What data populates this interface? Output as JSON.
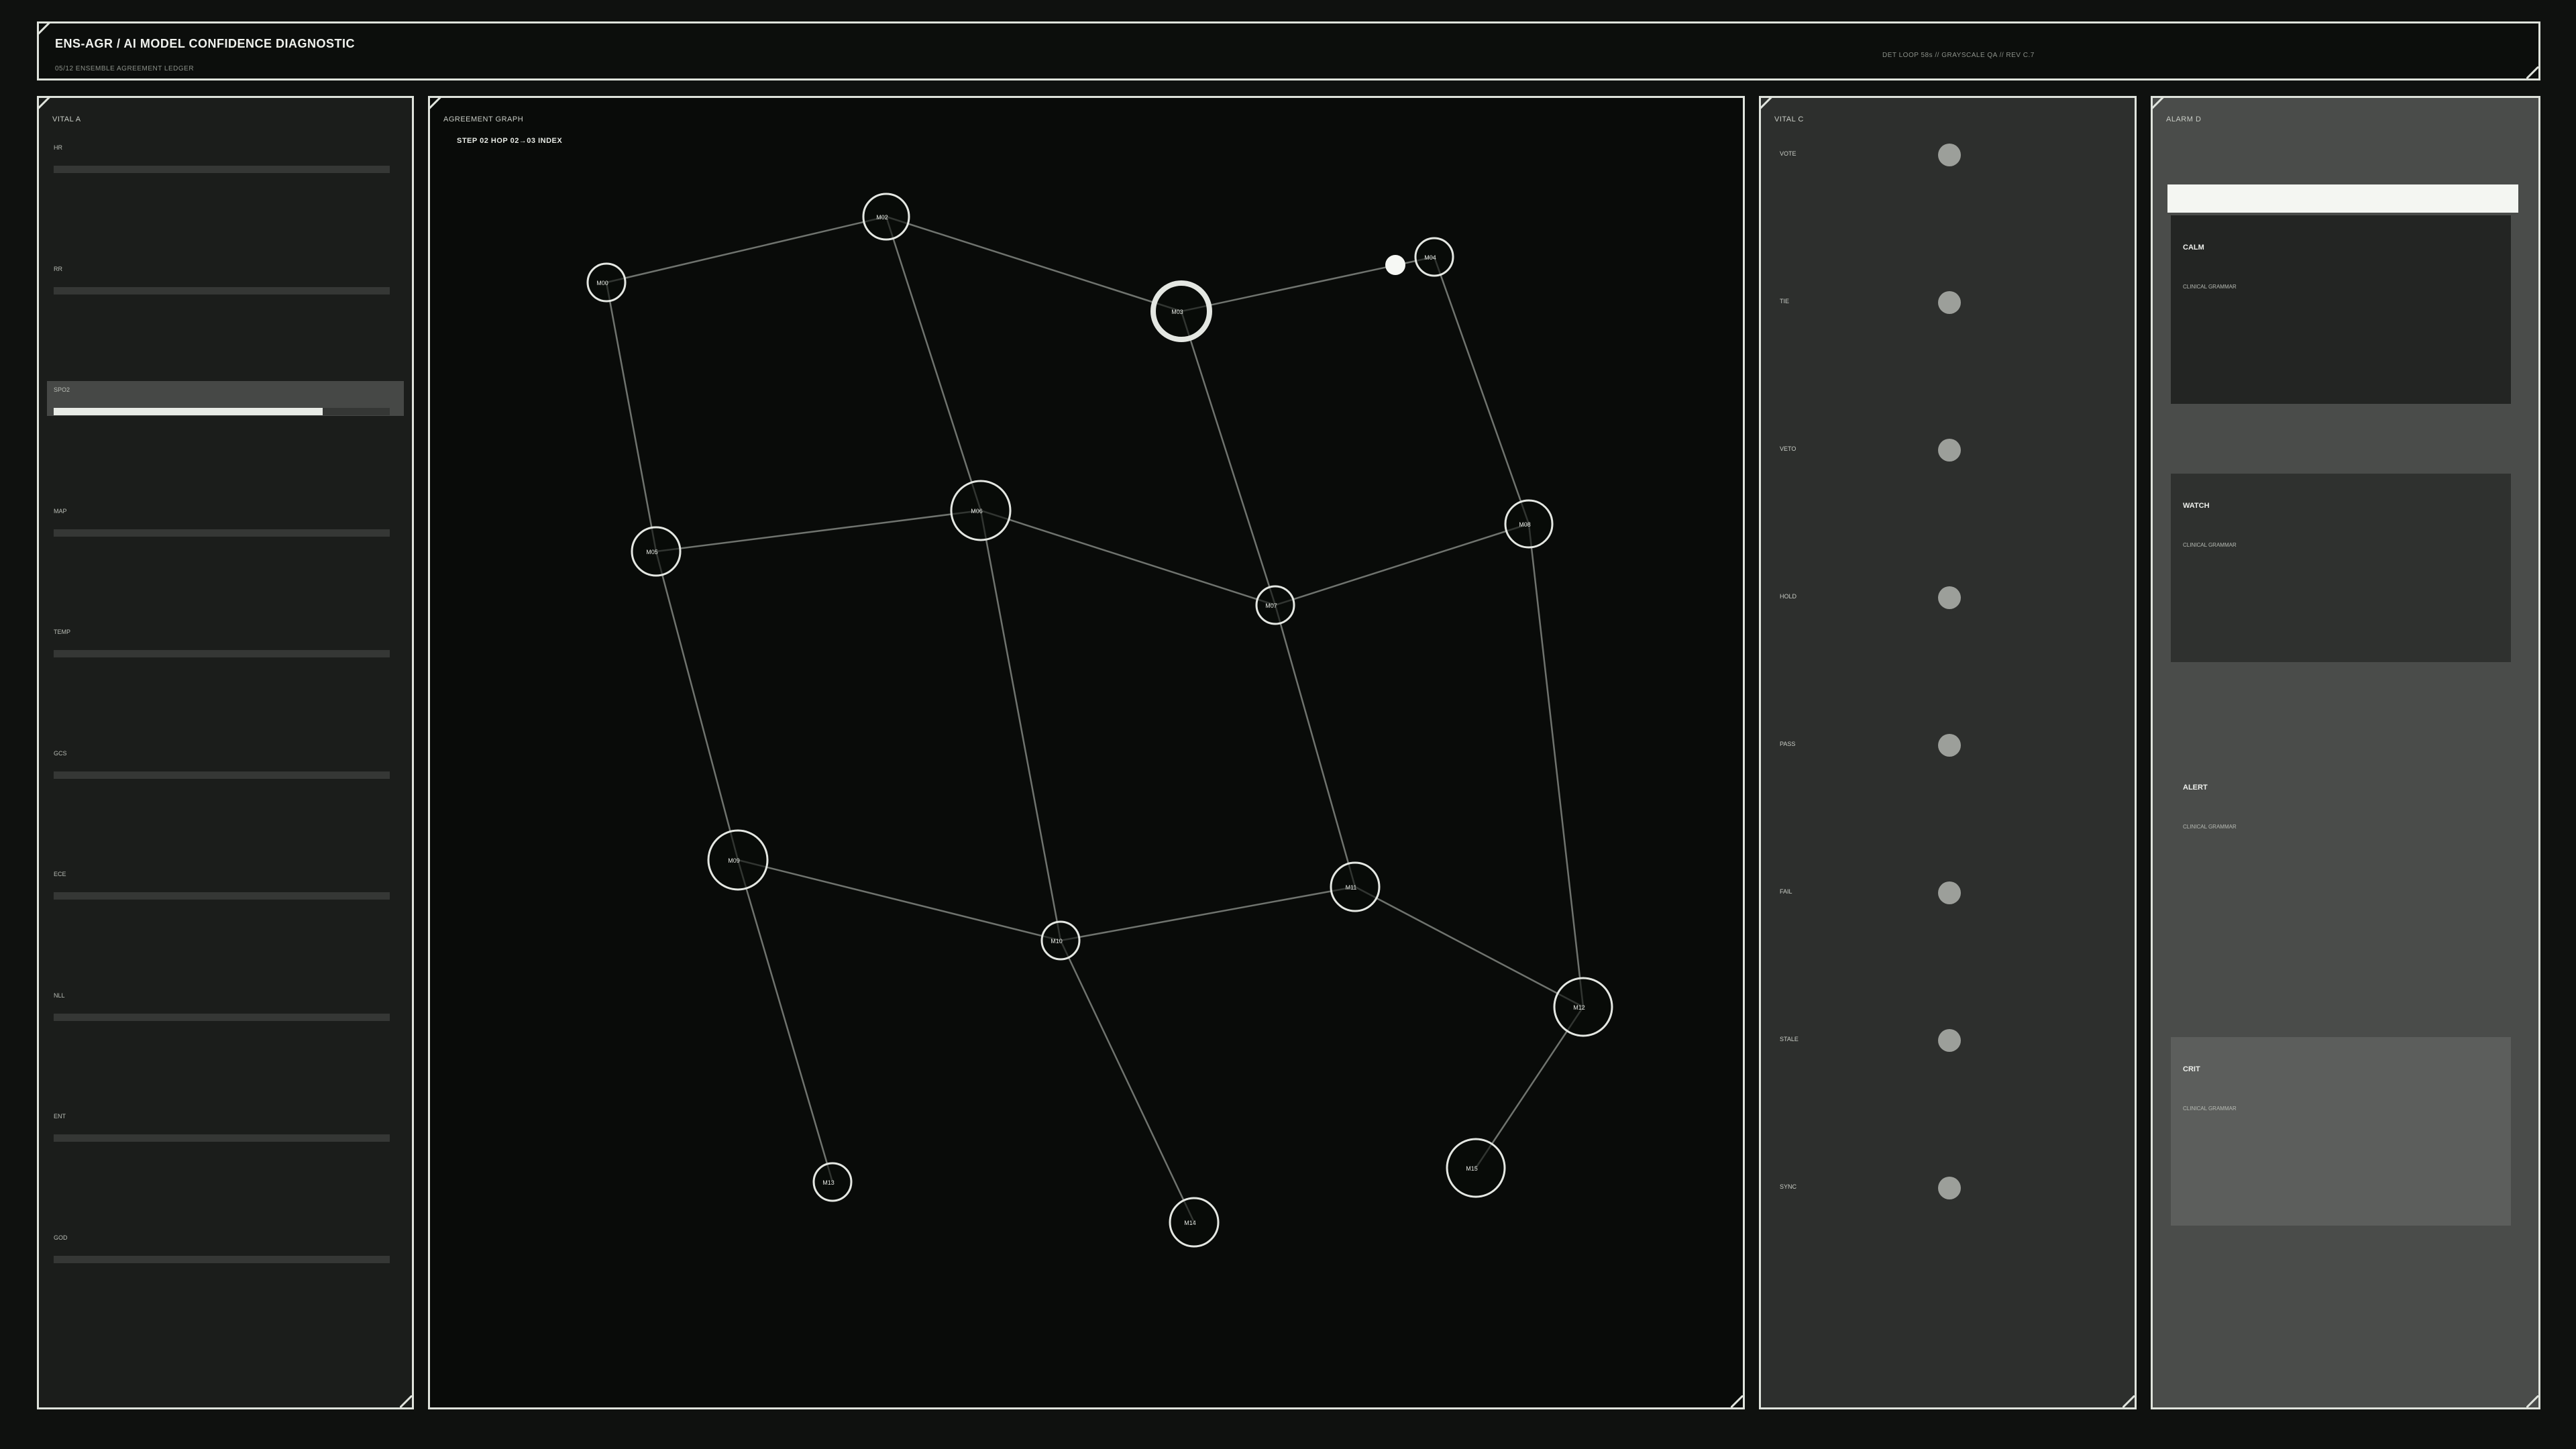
{
  "header": {
    "title": "ENS-AGR  /  AI MODEL CONFIDENCE DIAGNOSTIC",
    "subtitle": "05/12  ENSEMBLE AGREEMENT LEDGER",
    "meta": "DET LOOP 58s  //  GRAYSCALE QA  //  REV C.7"
  },
  "vital_a": {
    "label": "VITAL A",
    "rows": [
      {
        "label": "HR",
        "value": 0.0,
        "active": false
      },
      {
        "label": "RR",
        "value": 0.0,
        "active": false
      },
      {
        "label": "SPO2",
        "value": 0.8,
        "active": true
      },
      {
        "label": "MAP",
        "value": 0.0,
        "active": false
      },
      {
        "label": "TEMP",
        "value": 0.0,
        "active": false
      },
      {
        "label": "GCS",
        "value": 0.0,
        "active": false
      },
      {
        "label": "ECE",
        "value": 0.0,
        "active": false
      },
      {
        "label": "NLL",
        "value": 0.0,
        "active": false
      },
      {
        "label": "ENT",
        "value": 0.0,
        "active": false
      },
      {
        "label": "GOD",
        "value": 0.0,
        "active": false
      }
    ]
  },
  "graph": {
    "label": "AGREEMENT GRAPH",
    "step": "STEP 02  HOP 02→03  INDEX",
    "nodes": [
      {
        "id": "M00",
        "label": "M00",
        "r": 28
      },
      {
        "id": "M02",
        "label": "M02",
        "r": 34
      },
      {
        "id": "M03",
        "label": "M03",
        "r": 42,
        "active": true
      },
      {
        "id": "M04",
        "label": "M04",
        "r": 28
      },
      {
        "id": "M05",
        "label": "M05",
        "r": 36
      },
      {
        "id": "M06",
        "label": "M06",
        "r": 44
      },
      {
        "id": "M07",
        "label": "M07",
        "r": 28
      },
      {
        "id": "M08",
        "label": "M08",
        "r": 35
      },
      {
        "id": "M09",
        "label": "M09",
        "r": 44
      },
      {
        "id": "M10",
        "label": "M10",
        "r": 28
      },
      {
        "id": "M11",
        "label": "M11",
        "r": 36
      },
      {
        "id": "M12",
        "label": "M12",
        "r": 43
      },
      {
        "id": "M13",
        "label": "M13",
        "r": 28
      },
      {
        "id": "M14",
        "label": "M14",
        "r": 36
      },
      {
        "id": "M15",
        "label": "M15",
        "r": 43
      }
    ],
    "edges": [
      [
        "M00",
        "M02"
      ],
      [
        "M02",
        "M03"
      ],
      [
        "M03",
        "M04"
      ],
      [
        "M00",
        "M05"
      ],
      [
        "M02",
        "M06"
      ],
      [
        "M03",
        "M07"
      ],
      [
        "M04",
        "M08"
      ],
      [
        "M05",
        "M06"
      ],
      [
        "M06",
        "M07"
      ],
      [
        "M07",
        "M08"
      ],
      [
        "M05",
        "M09"
      ],
      [
        "M06",
        "M10"
      ],
      [
        "M07",
        "M11"
      ],
      [
        "M08",
        "M12"
      ],
      [
        "M09",
        "M10"
      ],
      [
        "M10",
        "M11"
      ],
      [
        "M11",
        "M12"
      ],
      [
        "M09",
        "M13"
      ],
      [
        "M10",
        "M14"
      ],
      [
        "M12",
        "M15"
      ]
    ]
  },
  "vital_c": {
    "label": "VITAL C",
    "rows": [
      "VOTE",
      "TIE",
      "VETO",
      "HOLD",
      "PASS",
      "FAIL",
      "STALE",
      "SYNC"
    ]
  },
  "alarm_d": {
    "label": "ALARM D",
    "boxes": [
      {
        "title": "CALM",
        "sub": "CLINICAL GRAMMAR",
        "color": "#232523"
      },
      {
        "title": "WATCH",
        "sub": "CLINICAL GRAMMAR",
        "color": "#2f312f"
      },
      {
        "title": "ALERT",
        "sub": "CLINICAL GRAMMAR",
        "color": "#4a4c4a"
      },
      {
        "title": "CRIT",
        "sub": "CLINICAL GRAMMAR",
        "color": "#5c5e5c"
      }
    ]
  }
}
